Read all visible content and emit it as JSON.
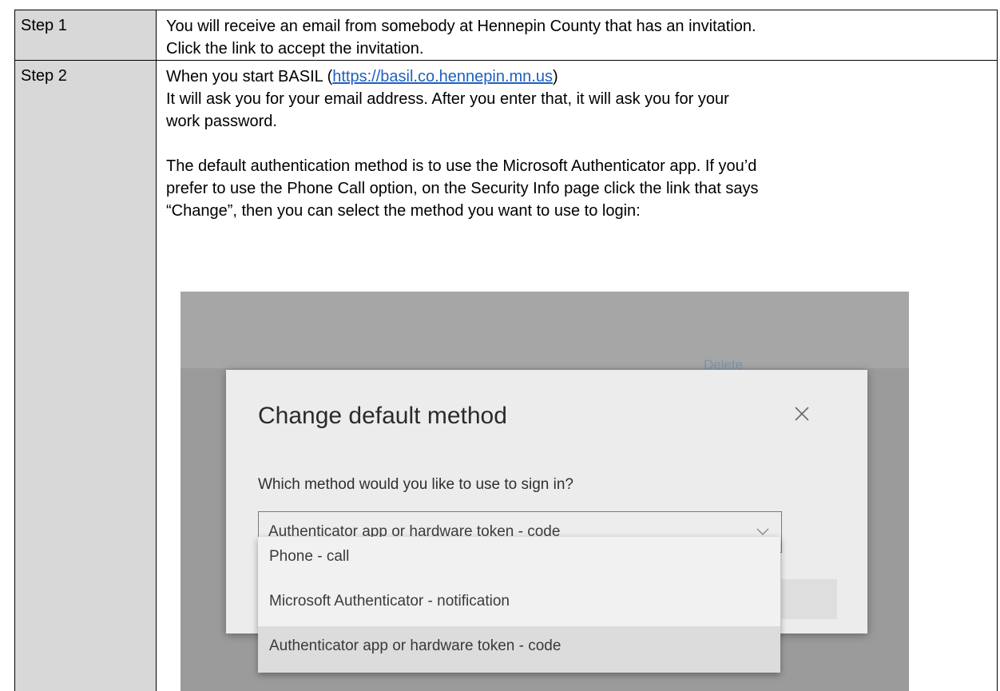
{
  "steps": [
    {
      "label": "Step 1",
      "lines": [
        "You will receive an email from somebody at Hennepin County that has an invitation.",
        "Click the link to accept the invitation."
      ]
    },
    {
      "label": "Step 2",
      "intro_prefix": "When you start BASIL (",
      "link_text": "https://basil.co.hennepin.mn.us",
      "intro_suffix": ")",
      "lines": [
        "It will ask you for your email address.  After you enter that, it will ask you for your",
        "work password."
      ],
      "lines2": [
        "The default authentication method is to use the Microsoft Authenticator app.  If you’d",
        "prefer to use the Phone Call option, on the Security Info page click the link that says",
        "“Change”, then you can select the method you want to use to login:"
      ]
    }
  ],
  "screenshot": {
    "background_link": "Delete",
    "dialog": {
      "title": "Change default method",
      "close_icon": "close-icon",
      "question": "Which method would you like to use to sign in?",
      "selected_value": "Authenticator app or hardware token - code",
      "options": [
        "Phone - call",
        "Microsoft Authenticator - notification",
        "Authenticator app or hardware token - code"
      ]
    }
  },
  "colors": {
    "label_cell": "#d8d8d8",
    "link": "#1f5fbf",
    "screenshot_backdrop": "#9b9b9b"
  }
}
